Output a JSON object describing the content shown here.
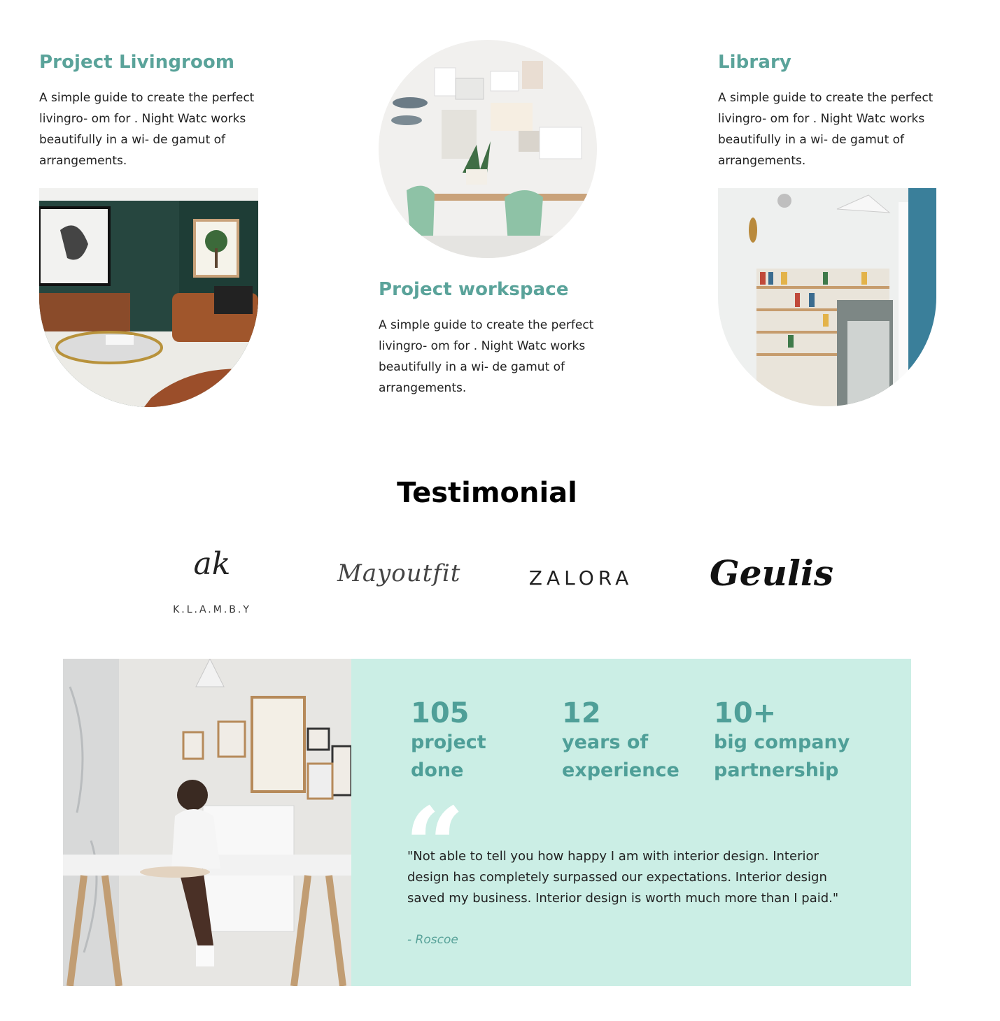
{
  "projects": [
    {
      "title": "Project Livingroom",
      "description": "A simple guide to create the perfect livingro- om for . Night Watc works beautifully in a wi- de gamut of arrangements.",
      "image_icon": "livingroom-photo"
    },
    {
      "title": "Project workspace",
      "description": "A simple guide to create the perfect livingro- om for . Night Watc works beautifully in a wi- de gamut of arrangements.",
      "image_icon": "workspace-photo"
    },
    {
      "title": "Library",
      "description": "A simple guide to create the perfect livingro- om for . Night Watc works beautifully in a wi- de gamut of arrangements.",
      "image_icon": "library-photo"
    }
  ],
  "testimonial": {
    "heading": "Testimonial",
    "logos": [
      {
        "name": "KLAMBY",
        "monogram": "ak",
        "text": "K.L.A.M.B.Y"
      },
      {
        "name": "Mayoutfit",
        "text": "Mayoutfit"
      },
      {
        "name": "ZALORA",
        "text": "ZALORA"
      },
      {
        "name": "Geulis",
        "text": "Geulis"
      }
    ],
    "stats": [
      {
        "number": "105",
        "label_line1": "project",
        "label_line2": "done"
      },
      {
        "number": "12",
        "label_line1": "years of",
        "label_line2": "experience"
      },
      {
        "number": "10+",
        "label_line1": "big company",
        "label_line2": "partnership"
      }
    ],
    "quote_mark": "“",
    "quote": "\"Not able to tell you how happy I am with interior design. Interior design has completely surpassed our expectations. Interior design saved my business. Interior design is worth much more than I paid.\"",
    "author": "- Roscoe"
  },
  "colors": {
    "accent": "#5aa39a",
    "panel": "#cbeee5",
    "heading": "#000000"
  }
}
